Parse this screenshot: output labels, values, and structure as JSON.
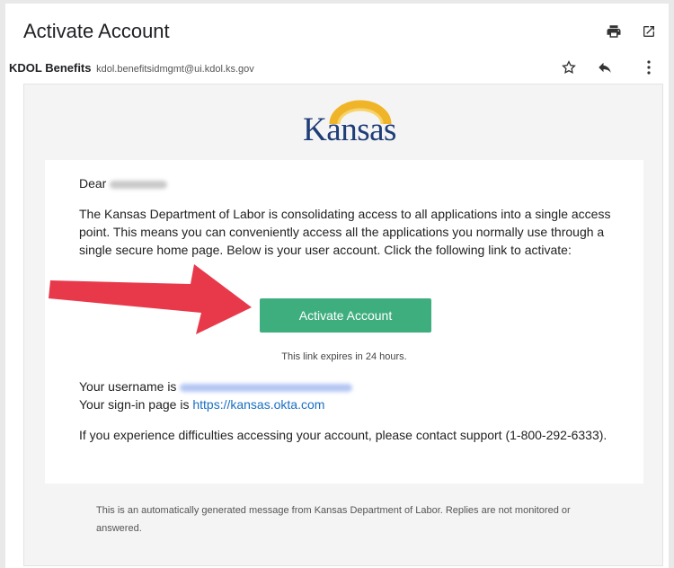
{
  "header": {
    "subject": "Activate Account",
    "sender_name": "KDOL Benefits",
    "sender_email": "kdol.benefitsidmgmt@ui.kdol.ks.gov",
    "icons": [
      "print-icon",
      "open-in-new-window-icon",
      "star-icon",
      "reply-icon",
      "more-options-icon"
    ]
  },
  "logo": {
    "text": "Kansas"
  },
  "email": {
    "greeting": "Dear",
    "paragraph": "The Kansas Department of Labor is consolidating access to all applications into a single access point. This means you can conveniently access all the applications you normally use through a single secure home page. Below is your user account. Click the following link to activate:",
    "button_label": "Activate Account",
    "expires": "This link expires in 24 hours.",
    "username_label": "Your username is",
    "signin_label": "Your sign-in page is",
    "signin_url": "https://kansas.okta.com",
    "support_text": "If you experience difficulties accessing your account, please contact support (1-800-292-6333)."
  },
  "footer": {
    "text": "This is an automatically generated message from Kansas Department of Labor. Replies are not monitored or answered."
  },
  "colors": {
    "button": "#3fae7f",
    "link": "#1a6fc2",
    "arrow": "#e8394b",
    "logo": "#1f3d78",
    "logo_sun": "#f0b429"
  }
}
